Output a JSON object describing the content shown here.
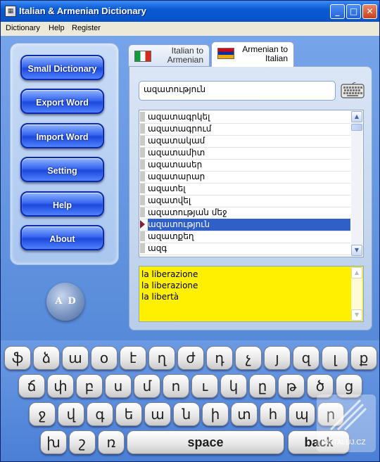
{
  "window": {
    "title": "Italian & Armenian Dictionary"
  },
  "title_buttons": {
    "minimize": "_",
    "maximize": "□",
    "close": "✕"
  },
  "menu": [
    "Dictionary",
    "Help",
    "Register"
  ],
  "sidebar": {
    "buttons": [
      "Small Dictionary",
      "Export Word",
      "Import Word",
      "Setting",
      "Help",
      "About"
    ],
    "logo_text": "AD"
  },
  "tabs": [
    {
      "line1": "Italian to",
      "line2": "Armenian",
      "flag": "italy-flag",
      "active": false
    },
    {
      "line1": "Armenian to",
      "line2": "Italian",
      "flag": "armenia-flag",
      "active": true
    }
  ],
  "search": {
    "value": "ազատություն"
  },
  "word_list": {
    "items": [
      "ազատագրկել",
      "ազատագրում",
      "ազատակամ",
      "ազատամիտ",
      "ազատասեր",
      "ազատարար",
      "ազատել",
      "ազատվել",
      "ազատության մեջ",
      "ազատություն",
      "ազատքեղ",
      "ազգ"
    ],
    "selected_index": 9
  },
  "translation": {
    "lines": [
      "la liberazione",
      "la liberazione",
      "la libertà"
    ]
  },
  "keyboard": {
    "rows": [
      [
        "ֆ",
        "ձ",
        "ա",
        "օ",
        "է",
        "ղ",
        "ժ",
        "դ",
        "չ",
        "յ",
        "զ",
        "լ",
        "ք"
      ],
      [
        "ճ",
        "փ",
        "բ",
        "ս",
        "մ",
        "ո",
        "ւ",
        "կ",
        "ը",
        "թ",
        "ծ",
        "ց"
      ],
      [
        "ջ",
        "վ",
        "գ",
        "ե",
        "ա",
        "ն",
        "ի",
        "տ",
        "հ",
        "պ",
        "ր"
      ],
      [
        "խ",
        "շ",
        "ռ"
      ]
    ],
    "space_label": "space",
    "back_label": "back"
  },
  "watermark": "INSTALUJ.CZ",
  "colors": {
    "accent": "#2f5fc7",
    "translation_bg": "#ffef00",
    "window_bg": "#5a8fd8"
  }
}
